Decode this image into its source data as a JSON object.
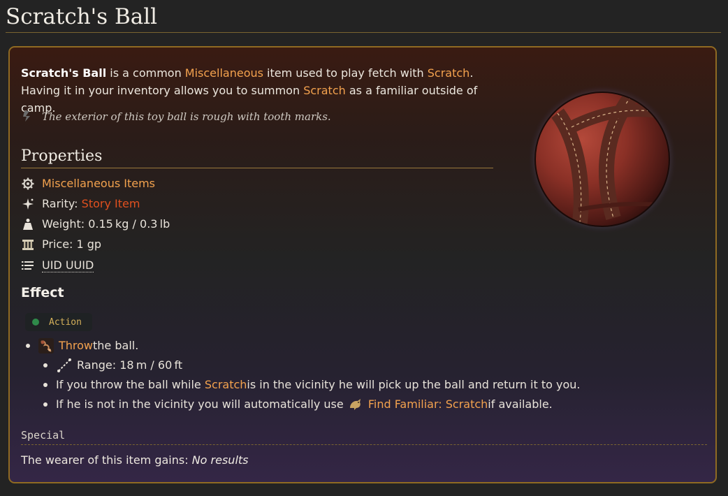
{
  "page": {
    "title": "Scratch's Ball"
  },
  "intro": {
    "item_name": "Scratch's Ball",
    "t1": " is a common ",
    "category_link": "Miscellaneous",
    "t2": " item used to play fetch with ",
    "scratch_link_1": "Scratch",
    "t3": ". Having it in your inventory allows you to summon ",
    "scratch_link_2": "Scratch",
    "t4": " as a familiar outside of camp."
  },
  "flavor": {
    "text": "The exterior of this toy ball is rough with tooth marks."
  },
  "properties": {
    "heading": "Properties",
    "category": "Miscellaneous Items",
    "rarity_label": "Rarity: ",
    "rarity_value": "Story Item",
    "weight": "Weight: 0.15 kg / 0.3 lb",
    "price": "Price: 1 gp",
    "uid": "UID UUID"
  },
  "effect": {
    "heading": "Effect",
    "chip_label": "Action",
    "throw_link": "Throw",
    "throw_rest": " the ball.",
    "range": "Range: 18 m / 60 ft",
    "line2_pre": "If you throw the ball while ",
    "line2_link": "Scratch",
    "line2_post": " is in the vicinity he will pick up the ball and return it to you.",
    "line3_pre": "If he is not in the vicinity you will automatically use ",
    "line3_link": "Find Familiar: Scratch",
    "line3_post": " if available."
  },
  "special": {
    "heading": "Special",
    "wearer_text": "The wearer of this item gains: ",
    "wearer_value": "No results"
  },
  "colors": {
    "link": "#f3a24e",
    "rarity": "#e0501f",
    "border": "#8f6a22",
    "chip_label": "#d4b05a",
    "chip_dot": "#2f8a4a"
  },
  "icons": [
    "quote-icon",
    "gear-icon",
    "sparkle-icon",
    "weight-icon",
    "price-icon",
    "list-icon",
    "throw-icon",
    "range-icon",
    "familiar-icon"
  ]
}
